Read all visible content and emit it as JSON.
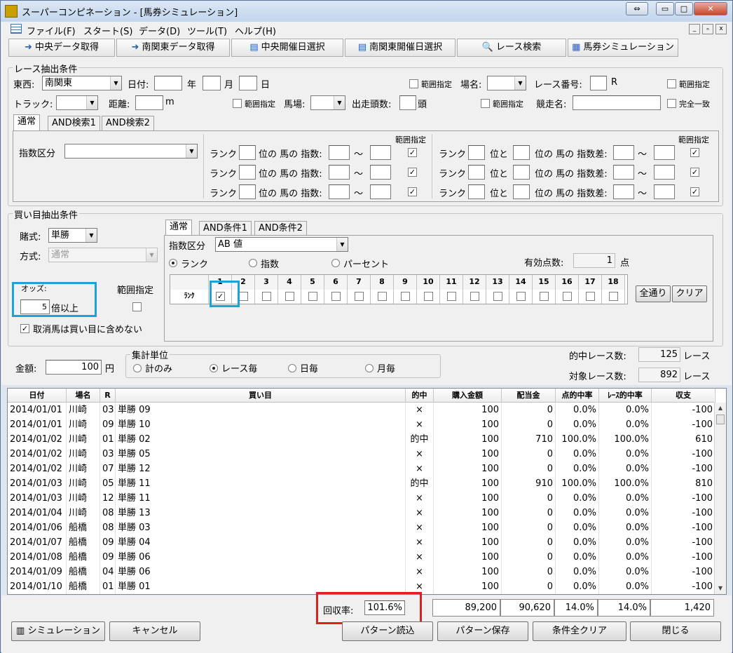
{
  "window": {
    "title": "スーパーコンピネーション - [馬券シミュレーション]",
    "min": "▭",
    "max": "□",
    "close": "✕",
    "restore_icon": "⇔"
  },
  "menu": [
    "ファイル(F)",
    "スタート(S)",
    "データ(D)",
    "ツール(T)",
    "ヘルプ(H)"
  ],
  "mdi_controls": [
    "_",
    "ₙ",
    "x"
  ],
  "toolbar": [
    {
      "label": "中央データ取得",
      "icon": "arrow-icon"
    },
    {
      "label": "南関東データ取得",
      "icon": "arrow-icon"
    },
    {
      "label": "中央開催日選択",
      "icon": "calendar-icon"
    },
    {
      "label": "南関東開催日選択",
      "icon": "calendar-icon"
    },
    {
      "label": "レース検索",
      "icon": "magnifier-icon"
    },
    {
      "label": "馬券シミュレーション",
      "icon": "table-icon"
    }
  ],
  "race": {
    "group_label": "レース抽出条件",
    "touzai_label": "東西:",
    "touzai_value": "南関東",
    "date_label": "日付:",
    "year_unit": "年",
    "month_unit": "月",
    "day_unit": "日",
    "range1": "範囲指定",
    "place_label": "場名:",
    "race_no_label": "レース番号:",
    "race_no_unit": "R",
    "range2": "範囲指定",
    "track_label": "トラック:",
    "distance_label": "距離:",
    "distance_unit": "m",
    "range3": "範囲指定",
    "baba_label": "馬場:",
    "entries_label": "出走頭数:",
    "entries_unit": "頭",
    "range4": "範囲指定",
    "race_name_label": "競走名:",
    "exact": "完全一致",
    "tabs": [
      "通常",
      "AND検索1",
      "AND検索2"
    ],
    "index_class_label": "指数区分",
    "rank_label": "ランク",
    "pos_index": "位の 馬の 指数:",
    "tilde": "〜",
    "range_header": "範囲指定",
    "pos_to": "位と",
    "pos_index_diff": "位の 馬の 指数差:"
  },
  "buy": {
    "group_label": "買い目抽出条件",
    "type_label": "賭式:",
    "type_value": "単勝",
    "method_label": "方式:",
    "method_value": "通常",
    "odds_label": "オッズ:",
    "odds_value": "5",
    "odds_unit": "倍以上",
    "range_label": "範囲指定",
    "cancel_excl": "取消馬は買い目に含めない",
    "tabs": [
      "通常",
      "AND条件1",
      "AND条件2"
    ],
    "index_class_label": "指数区分",
    "index_class_value": "AB 値",
    "radio_rank": "ランク",
    "radio_index": "指数",
    "radio_percent": "パーセント",
    "valid_points_label": "有効点数:",
    "valid_points_value": "1",
    "valid_points_unit": "点",
    "rank_row_label": "ﾗﾝｸ",
    "rank_numbers": [
      "1",
      "2",
      "3",
      "4",
      "5",
      "6",
      "7",
      "8",
      "9",
      "10",
      "11",
      "12",
      "13",
      "14",
      "15",
      "16",
      "17",
      "18"
    ],
    "rank_checked": [
      true,
      false,
      false,
      false,
      false,
      false,
      false,
      false,
      false,
      false,
      false,
      false,
      false,
      false,
      false,
      false,
      false,
      false
    ],
    "all_button": "全通り",
    "clear_button": "クリア"
  },
  "amount": {
    "label": "金額:",
    "value": "100",
    "unit": "円"
  },
  "agg": {
    "group_label": "集計単位",
    "options": [
      "計のみ",
      "レース毎",
      "日毎",
      "月毎"
    ],
    "selected": 1
  },
  "stats": {
    "hit_label": "的中レース数:",
    "hit_value": "125",
    "target_label": "対象レース数:",
    "target_value": "892",
    "unit": "レース"
  },
  "table": {
    "headers": [
      "日付",
      "場名",
      "R",
      "買い目",
      "的中",
      "購入金額",
      "配当金",
      "点的中率",
      "ﾚｰｽ的中率",
      "収支"
    ],
    "rows": [
      [
        "2014/01/01",
        "川崎",
        "03",
        "単勝 09",
        "×",
        "100",
        "0",
        "0.0%",
        "0.0%",
        "-100"
      ],
      [
        "2014/01/01",
        "川崎",
        "09",
        "単勝 10",
        "×",
        "100",
        "0",
        "0.0%",
        "0.0%",
        "-100"
      ],
      [
        "2014/01/02",
        "川崎",
        "01",
        "単勝 02",
        "的中",
        "100",
        "710",
        "100.0%",
        "100.0%",
        "610"
      ],
      [
        "2014/01/02",
        "川崎",
        "03",
        "単勝 05",
        "×",
        "100",
        "0",
        "0.0%",
        "0.0%",
        "-100"
      ],
      [
        "2014/01/02",
        "川崎",
        "07",
        "単勝 12",
        "×",
        "100",
        "0",
        "0.0%",
        "0.0%",
        "-100"
      ],
      [
        "2014/01/03",
        "川崎",
        "05",
        "単勝 11",
        "的中",
        "100",
        "910",
        "100.0%",
        "100.0%",
        "810"
      ],
      [
        "2014/01/03",
        "川崎",
        "12",
        "単勝 11",
        "×",
        "100",
        "0",
        "0.0%",
        "0.0%",
        "-100"
      ],
      [
        "2014/01/04",
        "川崎",
        "08",
        "単勝 13",
        "×",
        "100",
        "0",
        "0.0%",
        "0.0%",
        "-100"
      ],
      [
        "2014/01/06",
        "船橋",
        "08",
        "単勝 03",
        "×",
        "100",
        "0",
        "0.0%",
        "0.0%",
        "-100"
      ],
      [
        "2014/01/07",
        "船橋",
        "09",
        "単勝 04",
        "×",
        "100",
        "0",
        "0.0%",
        "0.0%",
        "-100"
      ],
      [
        "2014/01/08",
        "船橋",
        "09",
        "単勝 06",
        "×",
        "100",
        "0",
        "0.0%",
        "0.0%",
        "-100"
      ],
      [
        "2014/01/09",
        "船橋",
        "04",
        "単勝 06",
        "×",
        "100",
        "0",
        "0.0%",
        "0.0%",
        "-100"
      ],
      [
        "2014/01/10",
        "船橋",
        "01",
        "単勝 01",
        "×",
        "100",
        "0",
        "0.0%",
        "0.0%",
        "-100"
      ]
    ]
  },
  "summary": {
    "return_label": "回収率:",
    "return_value": "101.6%",
    "purchase": "89,200",
    "payout": "90,620",
    "point_rate": "14.0%",
    "race_rate": "14.0%",
    "balance": "1,420"
  },
  "buttons": {
    "simulate": "シミュレーション",
    "cancel": "キャンセル",
    "load": "パターン読込",
    "save": "パターン保存",
    "clear_all": "条件全クリア",
    "close": "閉じる"
  },
  "colors": {
    "highlight_blue": "#1ea0d8",
    "highlight_red": "#e02020"
  }
}
